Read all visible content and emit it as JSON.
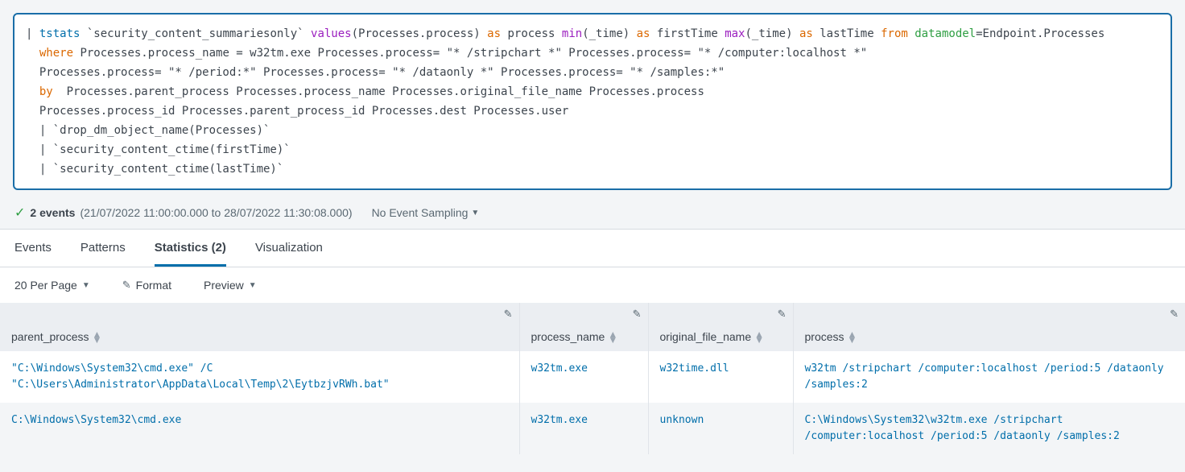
{
  "search": {
    "tokens": [
      [
        {
          "t": "| ",
          "c": "tok-pipe"
        },
        {
          "t": "tstats",
          "c": "tok-cmd"
        },
        {
          "t": " `security_content_summariesonly` ",
          "c": "tok-plain"
        },
        {
          "t": "values",
          "c": "tok-func"
        },
        {
          "t": "(Processes.process) ",
          "c": "tok-plain"
        },
        {
          "t": "as",
          "c": "tok-arg"
        },
        {
          "t": " process ",
          "c": "tok-plain"
        },
        {
          "t": "min",
          "c": "tok-func"
        },
        {
          "t": "(_time) ",
          "c": "tok-plain"
        },
        {
          "t": "as",
          "c": "tok-arg"
        },
        {
          "t": " firstTime ",
          "c": "tok-plain"
        },
        {
          "t": "max",
          "c": "tok-func"
        },
        {
          "t": "(_time) ",
          "c": "tok-plain"
        },
        {
          "t": "as",
          "c": "tok-arg"
        },
        {
          "t": " lastTime ",
          "c": "tok-plain"
        },
        {
          "t": "from",
          "c": "tok-clause"
        },
        {
          "t": " ",
          "c": "tok-plain"
        },
        {
          "t": "datamodel",
          "c": "tok-kw"
        },
        {
          "t": "=Endpoint.Processes",
          "c": "tok-plain"
        }
      ],
      [
        {
          "t": "  ",
          "c": "tok-plain"
        },
        {
          "t": "where",
          "c": "tok-clause"
        },
        {
          "t": " Processes.process_name = w32tm.exe Processes.process= \"* /stripchart *\" Processes.process= \"* /computer:localhost *\"",
          "c": "tok-plain"
        }
      ],
      [
        {
          "t": "  Processes.process= \"* /period:*\" Processes.process= \"* /dataonly *\" Processes.process= \"* /samples:*\"",
          "c": "tok-plain"
        }
      ],
      [
        {
          "t": "  ",
          "c": "tok-plain"
        },
        {
          "t": "by",
          "c": "tok-clause"
        },
        {
          "t": "  Processes.parent_process Processes.process_name Processes.original_file_name Processes.process",
          "c": "tok-plain"
        }
      ],
      [
        {
          "t": "  Processes.process_id Processes.parent_process_id Processes.dest Processes.user",
          "c": "tok-plain"
        }
      ],
      [
        {
          "t": "  | `drop_dm_object_name(Processes)`",
          "c": "tok-plain"
        }
      ],
      [
        {
          "t": "  | `security_content_ctime(firstTime)`",
          "c": "tok-plain"
        }
      ],
      [
        {
          "t": "  | `security_content_ctime(lastTime)`",
          "c": "tok-plain"
        }
      ]
    ]
  },
  "status": {
    "events_label": "2 events",
    "timerange": "(21/07/2022 11:00:00.000 to 28/07/2022 11:30:08.000)",
    "sampling": "No Event Sampling"
  },
  "tabs": {
    "events": "Events",
    "patterns": "Patterns",
    "statistics": "Statistics (2)",
    "visualization": "Visualization"
  },
  "toolbar": {
    "perpage": "20 Per Page",
    "format": "Format",
    "preview": "Preview"
  },
  "columns": {
    "parent_process": "parent_process",
    "process_name": "process_name",
    "original_file_name": "original_file_name",
    "process": "process"
  },
  "rows": [
    {
      "parent_process": "\"C:\\Windows\\System32\\cmd.exe\" /C \"C:\\Users\\Administrator\\AppData\\Local\\Temp\\2\\EytbzjvRWh.bat\"",
      "process_name": "w32tm.exe",
      "original_file_name": "w32time.dll",
      "process": "w32tm  /stripchart /computer:localhost /period:5 /dataonly /samples:2"
    },
    {
      "parent_process": "C:\\Windows\\System32\\cmd.exe",
      "process_name": "w32tm.exe",
      "original_file_name": "unknown",
      "process": "C:\\Windows\\System32\\w32tm.exe /stripchart /computer:localhost /period:5 /dataonly /samples:2"
    }
  ]
}
